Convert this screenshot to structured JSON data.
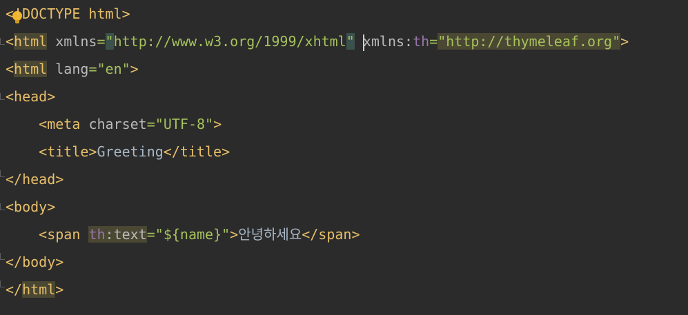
{
  "editor": {
    "language": "html",
    "lines": [
      {
        "doctype_open": "<",
        "doctype_rest": "!DOCTYPE html>"
      },
      {
        "open": "<",
        "tag": "html",
        "sp1": " ",
        "attr1": "xmlns",
        "eq1": "=",
        "q1": "\"",
        "val1": "http://www.w3.org/1999/xhtml",
        "q1e": "\"",
        "sp2": " ",
        "attr2": "xmlns:",
        "ns2": "th",
        "eq2": "=",
        "val2": "\"http://thymeleaf.org\"",
        "close": ">"
      },
      {
        "open": "<",
        "tag": "html",
        "sp1": " ",
        "attr1": "lang",
        "eq1": "=",
        "val1": "\"en\"",
        "close": ">"
      },
      {
        "open": "<",
        "tag": "head",
        "close": ">"
      },
      {
        "indent": "    ",
        "open": "<",
        "tag": "meta",
        "sp1": " ",
        "attr1": "charset",
        "eq1": "=",
        "val1": "\"UTF-8\"",
        "close": ">"
      },
      {
        "indent": "    ",
        "open_tag": "<title>",
        "text": "Greeting",
        "close_tag": "</title>"
      },
      {
        "open": "</",
        "tag": "head",
        "close": ">"
      },
      {
        "open": "<",
        "tag": "body",
        "close": ">"
      },
      {
        "indent": "    ",
        "open": "<",
        "tag": "span",
        "sp1": " ",
        "ns1": "th",
        "attr1": ":text",
        "eq1": "=",
        "val1": "\"${name}\"",
        "close": ">",
        "text": "안녕하세요",
        "close_tag": "</span>"
      },
      {
        "open": "</",
        "tag": "body",
        "close": ">"
      },
      {
        "open": "</",
        "tag": "html",
        "close": ">"
      }
    ]
  },
  "icons": {
    "bulb": "lightbulb-icon",
    "fold": "fold-marker-icon"
  }
}
